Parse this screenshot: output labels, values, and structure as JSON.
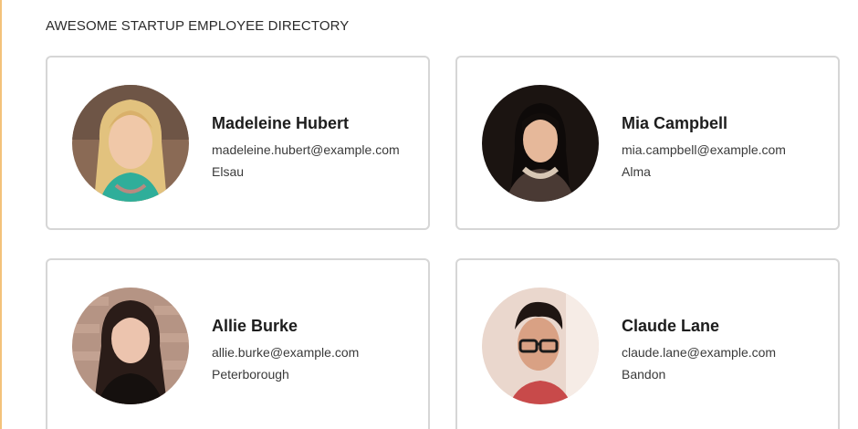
{
  "header": {
    "title": "AWESOME STARTUP EMPLOYEE DIRECTORY"
  },
  "employees": [
    {
      "name": "Madeleine Hubert",
      "email": "madeleine.hubert@example.com",
      "city": "Elsau",
      "avatar_icon": "person-photo"
    },
    {
      "name": "Mia Campbell",
      "email": "mia.campbell@example.com",
      "city": "Alma",
      "avatar_icon": "person-photo"
    },
    {
      "name": "Allie Burke",
      "email": "allie.burke@example.com",
      "city": "Peterborough",
      "avatar_icon": "person-photo"
    },
    {
      "name": "Claude Lane",
      "email": "claude.lane@example.com",
      "city": "Bandon",
      "avatar_icon": "person-photo"
    }
  ],
  "colors": {
    "accent_border": "#f3c27a",
    "card_border": "#d6d6d6"
  }
}
